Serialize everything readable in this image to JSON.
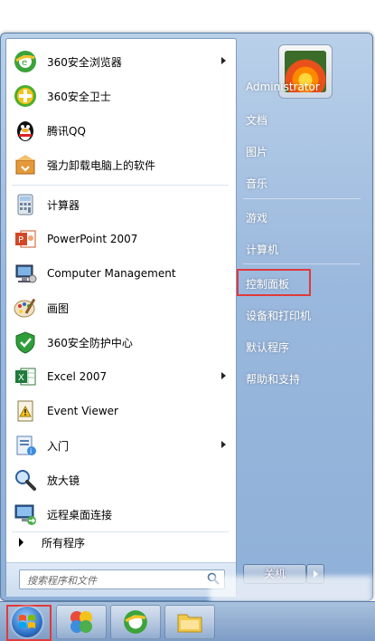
{
  "left_programs": [
    {
      "label": "360安全浏览器",
      "icon": "browser-360-icon",
      "arrow": true
    },
    {
      "label": "360安全卫士",
      "icon": "security-guard-360-icon",
      "arrow": false
    },
    {
      "label": "腾讯QQ",
      "icon": "qq-penguin-icon",
      "arrow": false
    },
    {
      "label": "强力卸载电脑上的软件",
      "icon": "uninstall-box-icon",
      "arrow": false
    },
    {
      "label": "计算器",
      "icon": "calculator-icon",
      "arrow": false
    },
    {
      "label": "PowerPoint 2007",
      "icon": "powerpoint-icon",
      "arrow": false
    },
    {
      "label": "Computer Management",
      "icon": "computer-management-icon",
      "arrow": false
    },
    {
      "label": "画图",
      "icon": "paint-palette-icon",
      "arrow": false
    },
    {
      "label": "360安全防护中心",
      "icon": "shield-360-icon",
      "arrow": false
    },
    {
      "label": "Excel 2007",
      "icon": "excel-icon",
      "arrow": true
    },
    {
      "label": "Event Viewer",
      "icon": "event-viewer-icon",
      "arrow": false
    },
    {
      "label": "入门",
      "icon": "getting-started-icon",
      "arrow": true
    },
    {
      "label": "放大镜",
      "icon": "magnifier-icon",
      "arrow": false
    },
    {
      "label": "远程桌面连接",
      "icon": "remote-desktop-icon",
      "arrow": false
    }
  ],
  "all_programs_label": "所有程序",
  "search_placeholder": "搜索程序和文件",
  "right_items": [
    {
      "label": "Administrator"
    },
    {
      "label": "文档"
    },
    {
      "label": "图片"
    },
    {
      "label": "音乐"
    },
    {
      "label": "游戏"
    },
    {
      "label": "计算机"
    },
    {
      "label": "控制面板",
      "highlighted": true
    },
    {
      "label": "设备和打印机"
    },
    {
      "label": "默认程序"
    },
    {
      "label": "帮助和支持"
    }
  ],
  "shutdown_label": "关机",
  "taskbar": [
    {
      "name": "start-button",
      "icon": "windows-orb-icon",
      "highlighted": true
    },
    {
      "name": "taskbar-app-colorful",
      "icon": "colorful-petals-icon"
    },
    {
      "name": "taskbar-app-360browser",
      "icon": "browser-360-icon"
    },
    {
      "name": "taskbar-app-explorer",
      "icon": "folder-icon"
    }
  ],
  "colors": {
    "highlight": "#e03a3a",
    "menu_blue": "#9ab8dd"
  }
}
